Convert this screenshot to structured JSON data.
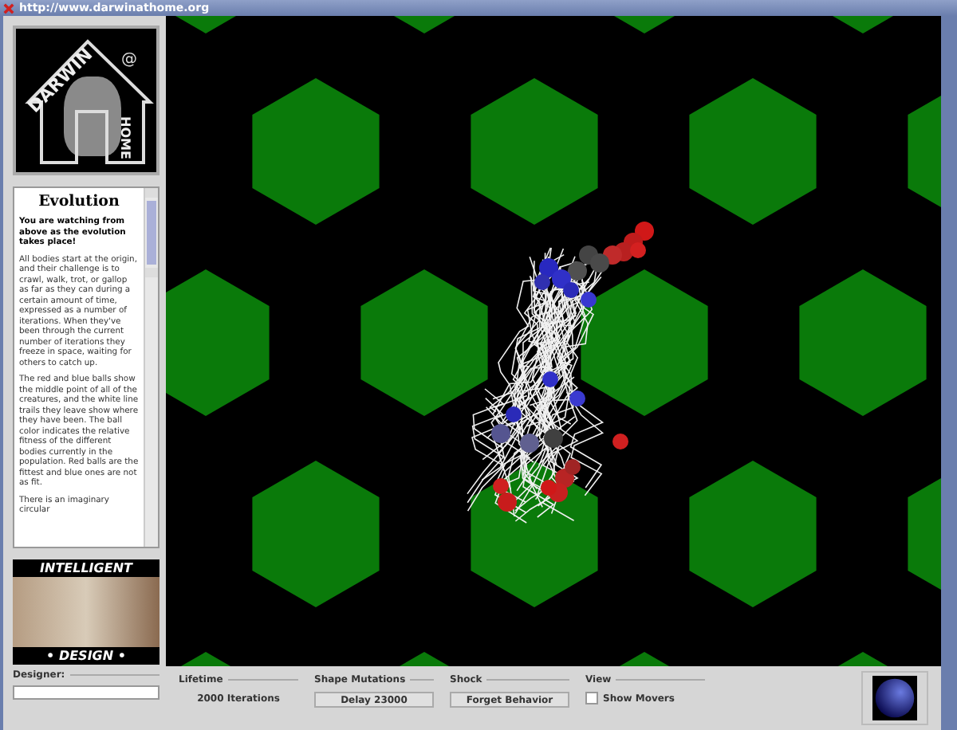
{
  "window": {
    "title": "http://www.darwinathome.org"
  },
  "logo": {
    "word_1": "DARWIN",
    "at": "@",
    "word_2": "HOME"
  },
  "info": {
    "heading": "Evolution",
    "lead": "You are watching from above as the evolution takes place!",
    "paragraphs": [
      "All bodies start at the origin, and their challenge is to crawl, walk, trot, or gallop as far as they can during a certain amount of time, expressed as a number of iterations. When they've been through the current number of iterations they freeze in space, waiting for others to catch up.",
      "The red and blue balls show the middle point of all of the creatures, and the white line trails they leave show where they have been. The ball color indicates the relative fitness of the different bodies currently in the population. Red balls are the fittest and blue ones are not as fit.",
      "There is an imaginary circular"
    ]
  },
  "banner": {
    "top": "INTELLIGENT",
    "bottom": "• DESIGN •"
  },
  "designer": {
    "label": "Designer:"
  },
  "controls": {
    "lifetime": {
      "label": "Lifetime",
      "value": "2000 Iterations"
    },
    "shape_mutations": {
      "label": "Shape Mutations",
      "button": "Delay 23000"
    },
    "shock": {
      "label": "Shock",
      "button": "Forget Behavior"
    },
    "view": {
      "label": "View",
      "checkbox": {
        "label": "Show Movers",
        "checked": false
      }
    }
  }
}
